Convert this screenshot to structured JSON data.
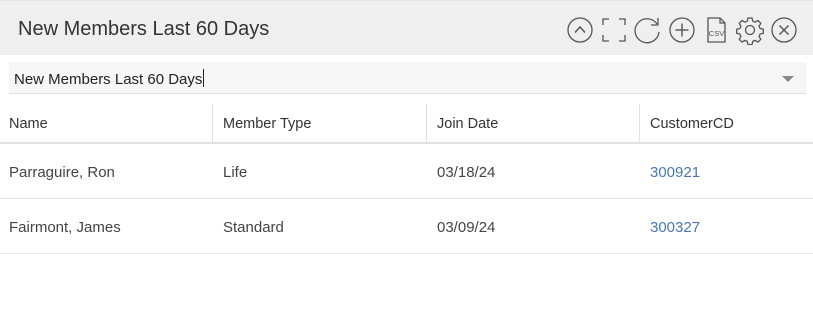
{
  "header": {
    "title": "New Members Last 60 Days",
    "tools": [
      {
        "icon": "collapse-icon",
        "label": "collapse"
      },
      {
        "icon": "fullscreen-icon",
        "label": "fullscreen"
      },
      {
        "icon": "refresh-icon",
        "label": "refresh"
      },
      {
        "icon": "add-icon",
        "label": "add"
      },
      {
        "icon": "csv-export-icon",
        "label": "CSV"
      },
      {
        "icon": "gear-icon",
        "label": "settings"
      },
      {
        "icon": "close-icon",
        "label": "close"
      }
    ]
  },
  "report_select": {
    "value": "New Members Last 60 Days"
  },
  "table": {
    "columns": [
      "Name",
      "Member Type",
      "Join Date",
      "CustomerCD"
    ],
    "rows": [
      [
        "Parraguire, Ron",
        "Life",
        "03/18/24",
        "300921"
      ],
      [
        "Fairmont, James",
        "Standard",
        "03/09/24",
        "300327"
      ]
    ]
  },
  "colors": {
    "header_bg": "#efefef",
    "icon_stroke": "#555555",
    "link": "#4a77b4"
  }
}
